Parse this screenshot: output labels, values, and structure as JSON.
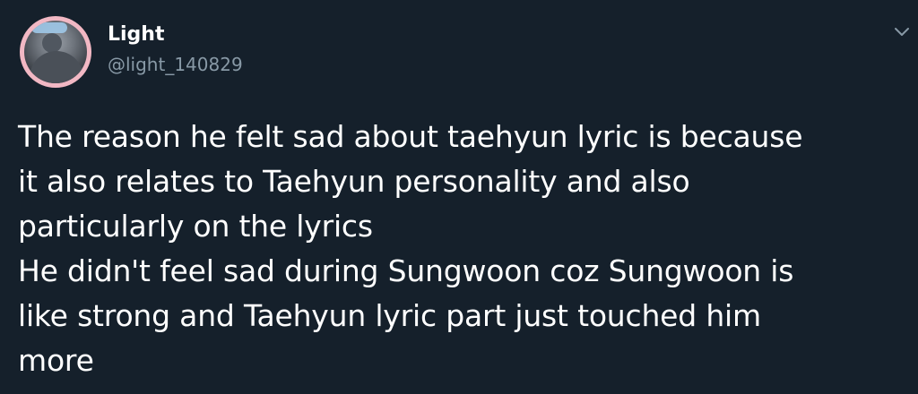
{
  "user": {
    "display_name": "Light",
    "handle": "@light_140829",
    "avatar_icon": "profile-photo"
  },
  "menu": {
    "icon": "chevron-down-icon"
  },
  "tweet": {
    "lines": [
      "The reason he felt sad about taehyun lyric is because",
      "it also relates to Taehyun personality and also",
      "particularly on the lyrics",
      "He didn't feel sad during Sungwoon coz Sungwoon is",
      "like strong and Taehyun lyric part just touched him",
      "more"
    ]
  },
  "colors": {
    "background": "#15202b",
    "text": "#ffffff",
    "secondary_text": "#8899a6",
    "avatar_ring": "#f2b8c4"
  }
}
